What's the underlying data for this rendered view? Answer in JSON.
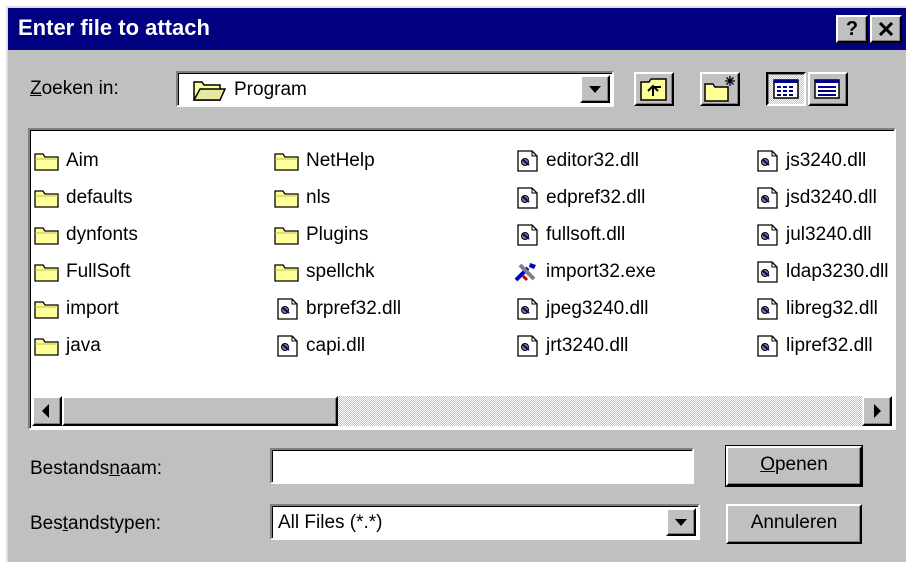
{
  "window": {
    "title": "Enter file to attach",
    "help_label": "?",
    "close_label": "✕"
  },
  "lookin": {
    "label_mnemonic": "Z",
    "label_rest": "oeken in:",
    "value": "Program"
  },
  "toolbar": [
    {
      "name": "up-one-level-button",
      "icon": "folder-up-icon"
    },
    {
      "name": "create-new-folder-button",
      "icon": "new-folder-icon"
    },
    {
      "name": "list-view-button",
      "icon": "list-view-icon",
      "pressed": true
    },
    {
      "name": "details-view-button",
      "icon": "details-view-icon",
      "pressed": false
    }
  ],
  "files": {
    "columns": [
      [
        {
          "name": "Aim",
          "type": "folder"
        },
        {
          "name": "defaults",
          "type": "folder"
        },
        {
          "name": "dynfonts",
          "type": "folder"
        },
        {
          "name": "FullSoft",
          "type": "folder"
        },
        {
          "name": "import",
          "type": "folder"
        },
        {
          "name": "java",
          "type": "folder"
        }
      ],
      [
        {
          "name": "NetHelp",
          "type": "folder"
        },
        {
          "name": "nls",
          "type": "folder"
        },
        {
          "name": "Plugins",
          "type": "folder"
        },
        {
          "name": "spellchk",
          "type": "folder"
        },
        {
          "name": "brpref32.dll",
          "type": "dll"
        },
        {
          "name": "capi.dll",
          "type": "dll"
        }
      ],
      [
        {
          "name": "editor32.dll",
          "type": "dll"
        },
        {
          "name": "edpref32.dll",
          "type": "dll"
        },
        {
          "name": "fullsoft.dll",
          "type": "dll"
        },
        {
          "name": "import32.exe",
          "type": "exe"
        },
        {
          "name": "jpeg3240.dll",
          "type": "dll"
        },
        {
          "name": "jrt3240.dll",
          "type": "dll"
        }
      ],
      [
        {
          "name": "js3240.dll",
          "type": "dll"
        },
        {
          "name": "jsd3240.dll",
          "type": "dll"
        },
        {
          "name": "jul3240.dll",
          "type": "dll"
        },
        {
          "name": "ldap3230.dll",
          "type": "dll"
        },
        {
          "name": "libreg32.dll",
          "type": "dll"
        },
        {
          "name": "lipref32.dll",
          "type": "dll"
        }
      ]
    ]
  },
  "filename": {
    "label_before": "Bestands",
    "label_mnemonic": "n",
    "label_after": "aam:",
    "value": ""
  },
  "filetype": {
    "label_before": "Bes",
    "label_mnemonic": "t",
    "label_after": "andstypen:",
    "value": "All Files (*.*)"
  },
  "buttons": {
    "open_mnemonic": "O",
    "open_rest": "penen",
    "cancel": "Annuleren"
  },
  "colors": {
    "titlebar": "#000080",
    "face": "#c0c0c0",
    "folder": "#ffff99"
  }
}
